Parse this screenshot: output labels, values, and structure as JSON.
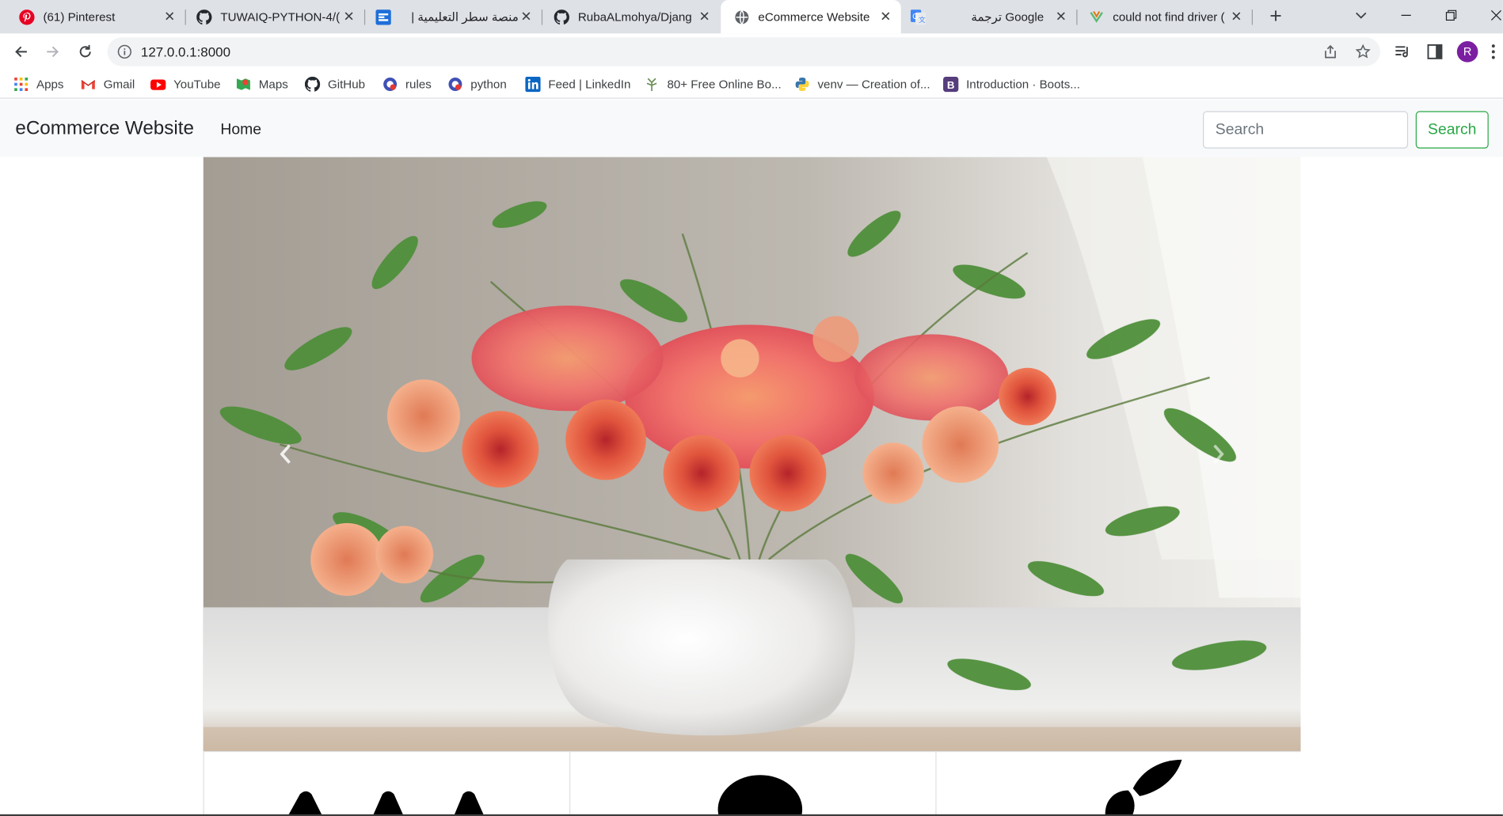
{
  "tabs": [
    {
      "title": "(61) Pinterest",
      "icon": "pinterest-icon"
    },
    {
      "title": "TUWAIQ-PYTHON-4/(",
      "icon": "github-icon"
    },
    {
      "title": "منصة سطر التعليمية |",
      "icon": "satr-icon"
    },
    {
      "title": "RubaALmohya/Djang",
      "icon": "github-icon"
    },
    {
      "title": "eCommerce Website",
      "icon": "globe-icon"
    },
    {
      "title": "Google ترجمة",
      "icon": "google-translate-icon"
    },
    {
      "title": "could not find driver (",
      "icon": "tab-favicon-icon"
    }
  ],
  "active_tab_index": 4,
  "address": {
    "url": "127.0.0.1:8000"
  },
  "profile": {
    "initial": "R"
  },
  "bookmarks": [
    {
      "label": "Apps",
      "icon": "apps-icon"
    },
    {
      "label": "Gmail",
      "icon": "gmail-icon"
    },
    {
      "label": "YouTube",
      "icon": "youtube-icon"
    },
    {
      "label": "Maps",
      "icon": "maps-icon"
    },
    {
      "label": "GitHub",
      "icon": "github-icon"
    },
    {
      "label": "rules",
      "icon": "bookmark-favicon-icon"
    },
    {
      "label": "python",
      "icon": "bookmark-favicon-icon"
    },
    {
      "label": "Feed | LinkedIn",
      "icon": "linkedin-icon"
    },
    {
      "label": "80+ Free Online Bo...",
      "icon": "bookmark-favicon-icon"
    },
    {
      "label": "venv — Creation of...",
      "icon": "python-icon"
    },
    {
      "label": "Introduction · Boots...",
      "icon": "bootstrap-icon"
    }
  ],
  "site": {
    "brand": "eCommerce Website",
    "nav_home": "Home",
    "search_placeholder": "Search",
    "search_button": "Search"
  },
  "colors": {
    "tabstrip": "#dee1e6",
    "nav_bg": "#f8f9fa",
    "search_green": "#28a745",
    "avatar": "#7b1fa2"
  }
}
